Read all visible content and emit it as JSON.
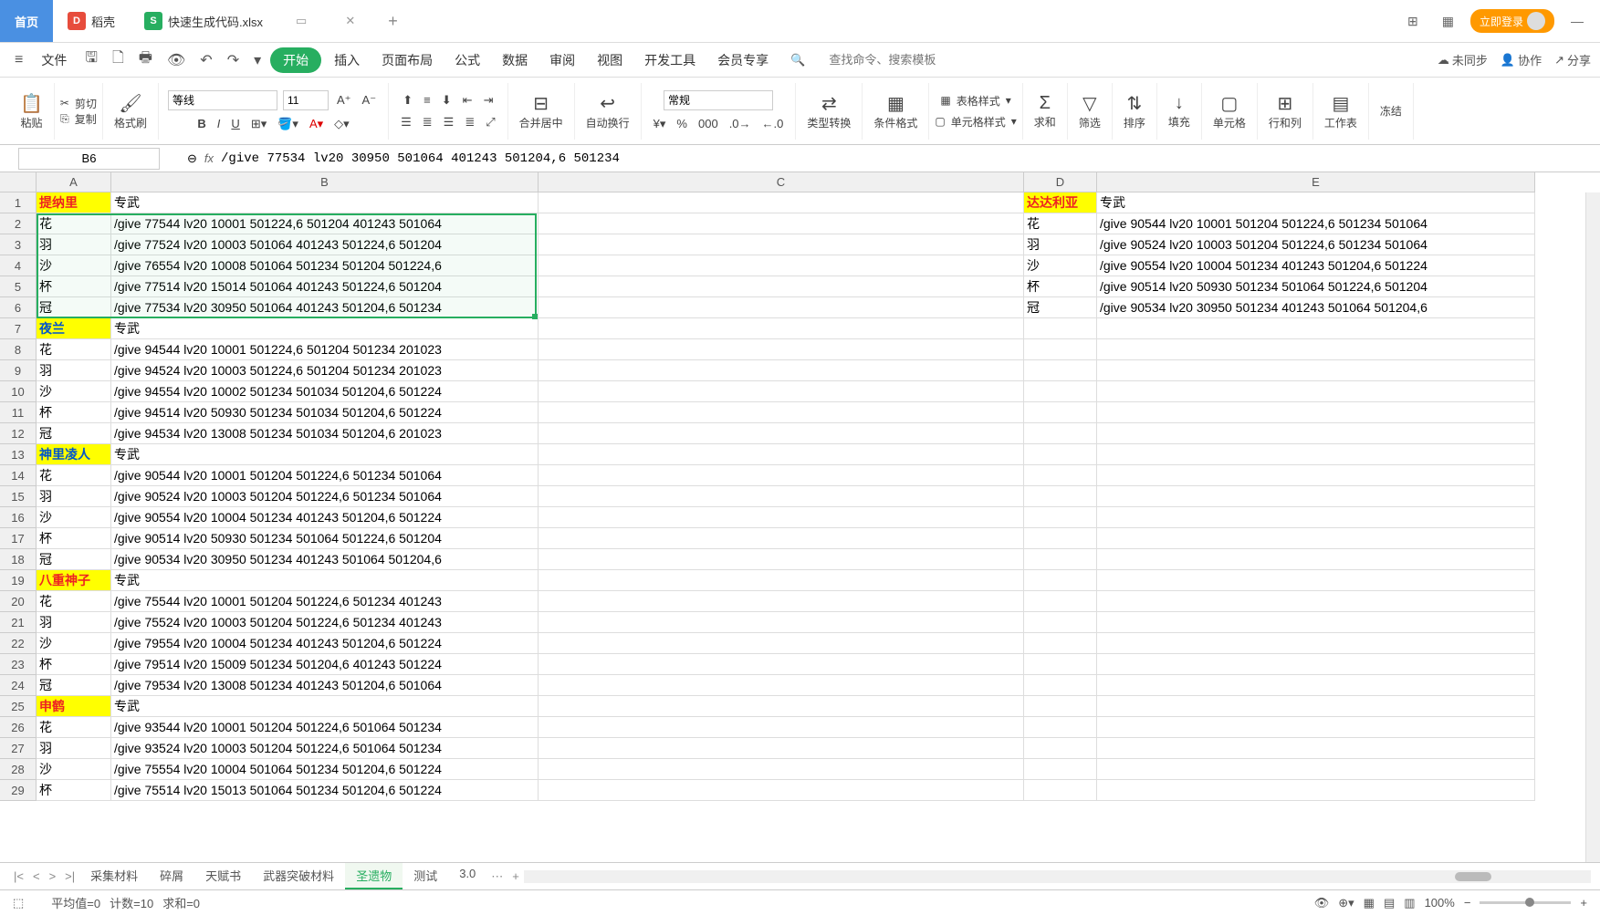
{
  "tabs": {
    "home": "首页",
    "dk": "稻壳",
    "file": "快速生成代码.xlsx"
  },
  "login": "立即登录",
  "menus": {
    "file": "文件",
    "start": "开始",
    "insert": "插入",
    "layout": "页面布局",
    "formula": "公式",
    "data": "数据",
    "review": "审阅",
    "view": "视图",
    "dev": "开发工具",
    "member": "会员专享"
  },
  "search_placeholder": "查找命令、搜索模板",
  "top_right": {
    "unsynced": "未同步",
    "collab": "协作",
    "share": "分享"
  },
  "ribbon": {
    "paste": "粘贴",
    "cut": "剪切",
    "copy": "复制",
    "fmt": "格式刷",
    "font": "等线",
    "size": "11",
    "merge": "合并居中",
    "wrap": "自动换行",
    "numfmt": "常规",
    "typecv": "类型转换",
    "cond": "条件格式",
    "tblstyle": "表格样式",
    "cellstyle": "单元格样式",
    "sum": "求和",
    "filter": "筛选",
    "sort": "排序",
    "fill": "填充",
    "cell": "单元格",
    "rowcol": "行和列",
    "sheet": "工作表",
    "freeze": "冻结"
  },
  "formula_bar": {
    "cell_ref": "B6",
    "formula": "/give 77534 lv20 30950 501064 401243 501204,6 501234"
  },
  "columns": [
    "A",
    "B",
    "C",
    "D",
    "E"
  ],
  "sheet": {
    "rows": [
      {
        "n": 1,
        "A": "提纳里",
        "Ac": "hdr-red",
        "B": "专武",
        "D": "达达利亚",
        "Dc": "hdr-red",
        "E": "专武"
      },
      {
        "n": 2,
        "A": "花",
        "B": "/give 77544 lv20 10001 501224,6 501204 401243 501064",
        "D": "花",
        "E": "/give 90544 lv20 10001 501204 501224,6 501234 501064"
      },
      {
        "n": 3,
        "A": "羽",
        "B": "/give 77524 lv20 10003 501064 401243 501224,6 501204",
        "D": "羽",
        "E": "/give 90524 lv20 10003 501204 501224,6 501234 501064"
      },
      {
        "n": 4,
        "A": "沙",
        "B": "/give 76554 lv20 10008 501064 501234 501204 501224,6",
        "D": "沙",
        "E": "/give 90554 lv20 10004 501234 401243 501204,6 501224"
      },
      {
        "n": 5,
        "A": "杯",
        "B": "/give 77514 lv20 15014 501064 401243 501224,6 501204",
        "D": "杯",
        "E": "/give 90514 lv20 50930 501234 501064 501224,6 501204"
      },
      {
        "n": 6,
        "A": "冠",
        "B": "/give 77534 lv20 30950 501064 401243 501204,6 501234",
        "D": "冠",
        "E": "/give 90534 lv20 30950 501234 401243 501064 501204,6"
      },
      {
        "n": 7,
        "A": "夜兰",
        "Ac": "hdr-blue",
        "B": "专武"
      },
      {
        "n": 8,
        "A": "花",
        "B": "/give 94544 lv20 10001 501224,6 501204 501234 201023"
      },
      {
        "n": 9,
        "A": "羽",
        "B": "/give 94524 lv20 10003 501224,6 501204 501234 201023"
      },
      {
        "n": 10,
        "A": "沙",
        "B": "/give 94554 lv20 10002 501234 501034 501204,6 501224"
      },
      {
        "n": 11,
        "A": "杯",
        "B": "/give 94514 lv20 50930 501234 501034 501204,6 501224"
      },
      {
        "n": 12,
        "A": "冠",
        "B": "/give 94534 lv20 13008 501234 501034 501204,6 201023"
      },
      {
        "n": 13,
        "A": "神里凌人",
        "Ac": "hdr-blue",
        "B": "专武"
      },
      {
        "n": 14,
        "A": "花",
        "B": "/give 90544 lv20 10001 501204 501224,6 501234 501064"
      },
      {
        "n": 15,
        "A": "羽",
        "B": "/give 90524 lv20 10003 501204 501224,6 501234 501064"
      },
      {
        "n": 16,
        "A": "沙",
        "B": "/give 90554 lv20 10004 501234 401243 501204,6 501224"
      },
      {
        "n": 17,
        "A": "杯",
        "B": "/give 90514 lv20 50930 501234 501064 501224,6 501204"
      },
      {
        "n": 18,
        "A": "冠",
        "B": "/give 90534 lv20 30950 501234 401243 501064 501204,6"
      },
      {
        "n": 19,
        "A": "八重神子",
        "Ac": "hdr-red",
        "B": "专武"
      },
      {
        "n": 20,
        "A": "花",
        "B": "/give 75544 lv20 10001 501204 501224,6 501234 401243"
      },
      {
        "n": 21,
        "A": "羽",
        "B": "/give 75524 lv20 10003 501204 501224,6 501234 401243"
      },
      {
        "n": 22,
        "A": "沙",
        "B": "/give 79554 lv20 10004 501234 401243 501204,6 501224"
      },
      {
        "n": 23,
        "A": "杯",
        "B": "/give 79514 lv20 15009 501234 501204,6 401243 501224"
      },
      {
        "n": 24,
        "A": "冠",
        "B": "/give 79534 lv20 13008 501234 401243 501204,6 501064"
      },
      {
        "n": 25,
        "A": "申鹤",
        "Ac": "hdr-red",
        "B": "专武"
      },
      {
        "n": 26,
        "A": "花",
        "B": "/give 93544 lv20 10001 501204 501224,6 501064 501234"
      },
      {
        "n": 27,
        "A": "羽",
        "B": "/give 93524 lv20 10003 501204 501224,6 501064 501234"
      },
      {
        "n": 28,
        "A": "沙",
        "B": "/give 75554 lv20 10004 501064 501234 501204,6 501224"
      },
      {
        "n": 29,
        "A": "杯",
        "B": "/give 75514 lv20 15013 501064 501234 501204,6 501224"
      }
    ]
  },
  "sheet_tabs": [
    "采集材料",
    "碎屑",
    "天赋书",
    "武器突破材料",
    "圣遗物",
    "测试",
    "3.0"
  ],
  "active_sheet": "圣遗物",
  "status": {
    "avg": "平均值=0",
    "count": "计数=10",
    "sum": "求和=0",
    "zoom": "100%"
  }
}
